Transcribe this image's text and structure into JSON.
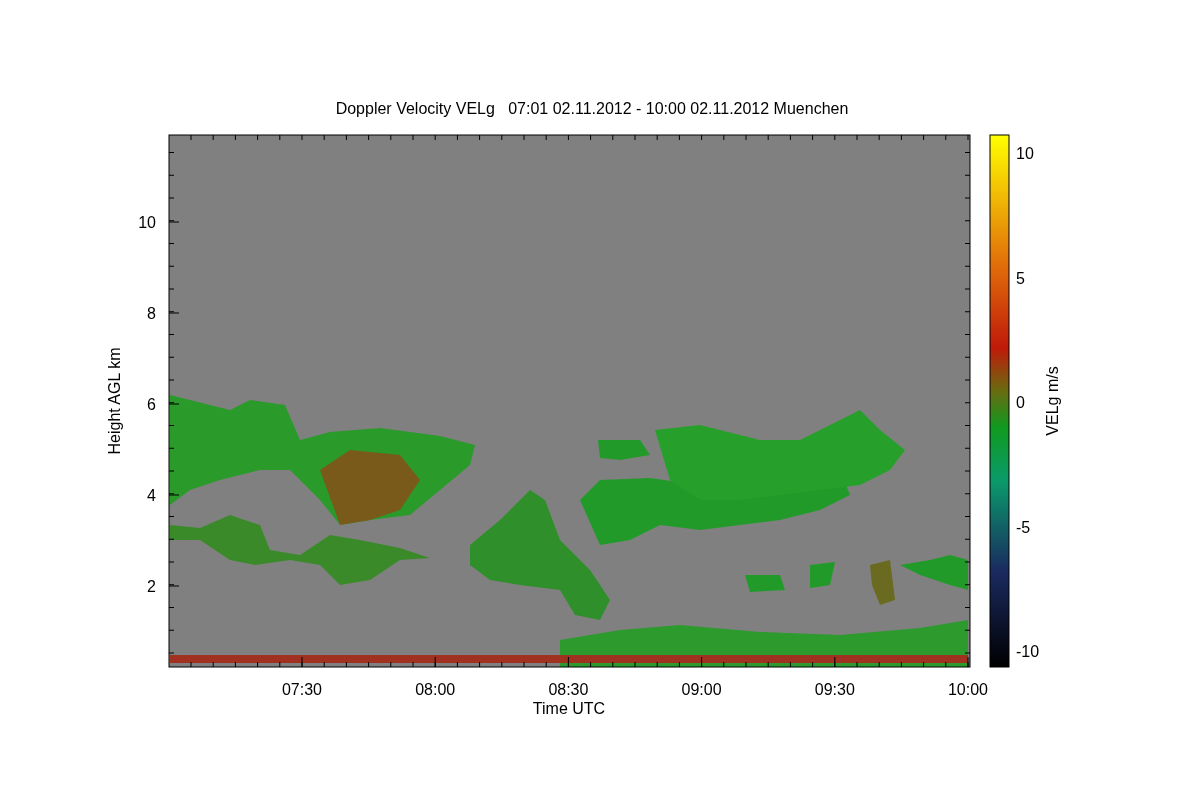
{
  "title": "Doppler Velocity VELg   07:01 02.11.2012 - 10:00 02.11.2012 Muenchen",
  "y_axis": {
    "label": "Height AGL km",
    "ticks": [
      "10",
      "8",
      "6",
      "4",
      "2"
    ]
  },
  "x_axis": {
    "label": "Time UTC",
    "ticks": [
      "07:30",
      "08:00",
      "08:30",
      "09:00",
      "09:30",
      "10:00"
    ]
  },
  "colorbar": {
    "label": "VELg m/s",
    "ticks": [
      "10",
      "5",
      "0",
      "-5",
      "-10"
    ]
  }
}
